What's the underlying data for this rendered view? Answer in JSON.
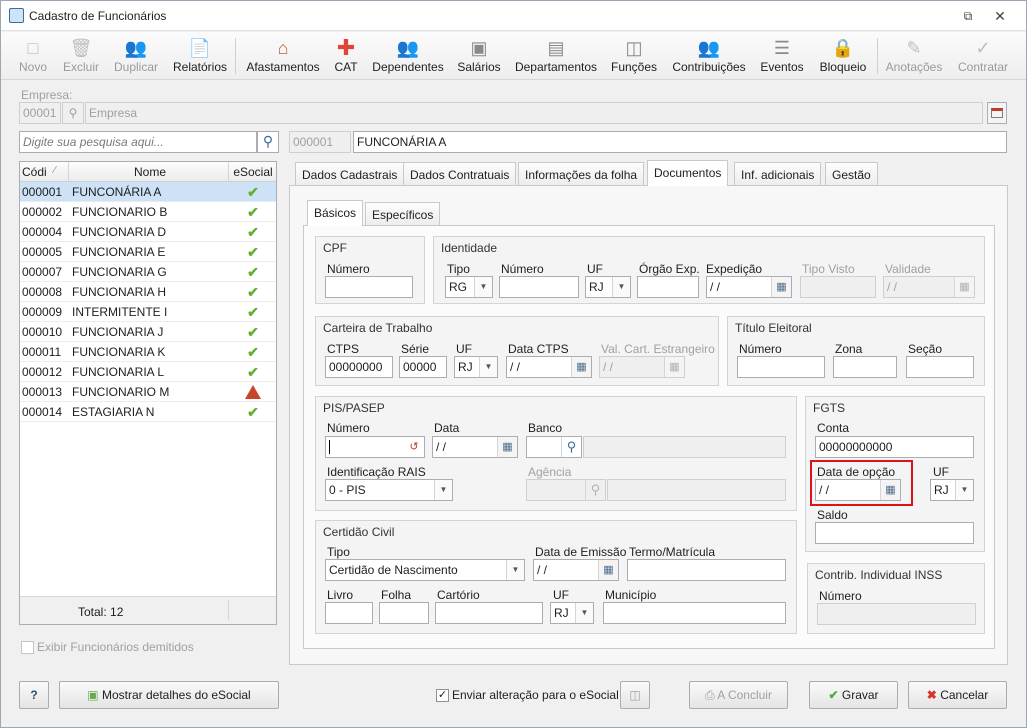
{
  "window": {
    "title": "Cadastro de Funcionários"
  },
  "toolbar": {
    "items": [
      {
        "label": "Novo",
        "icon": "new-doc-icon",
        "enabled": false
      },
      {
        "label": "Excluir",
        "icon": "trash-icon",
        "enabled": false
      },
      {
        "label": "Duplicar",
        "icon": "duplicate-users-icon",
        "enabled": false
      },
      {
        "label": "Relatórios",
        "icon": "report-icon",
        "enabled": true
      },
      {
        "label": "Afastamentos",
        "icon": "house-arrow-icon",
        "enabled": true
      },
      {
        "label": "CAT",
        "icon": "red-cross-icon",
        "enabled": true
      },
      {
        "label": "Dependentes",
        "icon": "people-icon",
        "enabled": true
      },
      {
        "label": "Salários",
        "icon": "money-icon",
        "enabled": true
      },
      {
        "label": "Departamentos",
        "icon": "desk-icon",
        "enabled": true
      },
      {
        "label": "Funções",
        "icon": "badge-icon",
        "enabled": true
      },
      {
        "label": "Contribuições",
        "icon": "contrib-people-icon",
        "enabled": true
      },
      {
        "label": "Eventos",
        "icon": "list-icon",
        "enabled": true
      },
      {
        "label": "Bloqueio",
        "icon": "lock-icon",
        "enabled": true
      },
      {
        "label": "Anotações",
        "icon": "notes-icon",
        "enabled": false
      },
      {
        "label": "Contratar",
        "icon": "hire-icon",
        "enabled": false
      }
    ]
  },
  "empresa": {
    "label": "Empresa:",
    "code": "00001",
    "name": "Empresa"
  },
  "search": {
    "placeholder": "Digite sua pesquisa aqui..."
  },
  "employee": {
    "code": "000001",
    "name": "FUNCONÁRIA A"
  },
  "grid": {
    "columns": [
      "Códi",
      "Nome",
      "eSocial"
    ],
    "rows": [
      {
        "code": "000001",
        "name": "FUNCONÁRIA A",
        "status": "ok"
      },
      {
        "code": "000002",
        "name": "FUNCIONARIO B",
        "status": "ok"
      },
      {
        "code": "000004",
        "name": "FUNCIONARIA D",
        "status": "ok"
      },
      {
        "code": "000005",
        "name": "FUNCIONARIA E",
        "status": "ok"
      },
      {
        "code": "000007",
        "name": "FUNCIONARIA G",
        "status": "ok"
      },
      {
        "code": "000008",
        "name": "FUNCIONARIA H",
        "status": "ok"
      },
      {
        "code": "000009",
        "name": "INTERMITENTE I",
        "status": "ok"
      },
      {
        "code": "000010",
        "name": "FUNCIONARIA J",
        "status": "ok"
      },
      {
        "code": "000011",
        "name": "FUNCIONARIA K",
        "status": "ok"
      },
      {
        "code": "000012",
        "name": "FUNCIONARIA L",
        "status": "ok"
      },
      {
        "code": "000013",
        "name": "FUNCIONARIO M",
        "status": "warning"
      },
      {
        "code": "000014",
        "name": "ESTAGIARIA N",
        "status": "ok"
      }
    ],
    "total": "Total: 12"
  },
  "show_dismissed": "Exibir Funcionários demitidos",
  "tabs": [
    "Dados Cadastrais",
    "Dados Contratuais",
    "Informações da folha",
    "Documentos",
    "Inf. adicionais",
    "Gestão"
  ],
  "subtabs": [
    "Básicos",
    "Específicos"
  ],
  "cpf": {
    "title": "CPF",
    "numero_label": "Número"
  },
  "identidade": {
    "title": "Identidade",
    "tipo_label": "Tipo",
    "tipo": "RG",
    "numero_label": "Número",
    "uf_label": "UF",
    "uf": "RJ",
    "orgao_label": "Órgão Exp.",
    "expedicao_label": "Expedição",
    "expedicao": " / /",
    "tipo_visto_label": "Tipo Visto",
    "validade_label": "Validade",
    "validade": " / /"
  },
  "ctps": {
    "title": "Carteira de Trabalho",
    "ctps_label": "CTPS",
    "ctps": "00000000",
    "serie_label": "Série",
    "serie": "00000",
    "uf_label": "UF",
    "uf": "RJ",
    "data_label": "Data CTPS",
    "data": " / /",
    "val_label": "Val. Cart. Estrangeiro",
    "val": " / /"
  },
  "titulo": {
    "title": "Título Eleitoral",
    "numero_label": "Número",
    "zona_label": "Zona",
    "secao_label": "Seção"
  },
  "pis": {
    "title": "PIS/PASEP",
    "numero_label": "Número",
    "data_label": "Data",
    "data": " / /",
    "banco_label": "Banco",
    "rais_label": "Identificação RAIS",
    "rais": "0 - PIS",
    "agencia_label": "Agência"
  },
  "fgts": {
    "title": "FGTS",
    "conta_label": "Conta",
    "conta": "00000000000",
    "opcao_label": "Data de opção",
    "opcao": " / /",
    "uf_label": "UF",
    "uf": "RJ",
    "saldo_label": "Saldo"
  },
  "certidao": {
    "title": "Certidão Civil",
    "tipo_label": "Tipo",
    "tipo": "Certidão de Nascimento",
    "emissao_label": "Data de Emissão",
    "emissao": " / /",
    "termo_label": "Termo/Matrícula",
    "livro_label": "Livro",
    "folha_label": "Folha",
    "cartorio_label": "Cartório",
    "uf_label": "UF",
    "uf": "RJ",
    "municipio_label": "Município"
  },
  "inss": {
    "title": "Contrib. Individual INSS",
    "numero_label": "Número"
  },
  "footer": {
    "help": "?",
    "esocial_details": "Mostrar detalhes do eSocial",
    "send_change": "Enviar alteração para o eSocial",
    "concluir": "A Concluir",
    "gravar": "Gravar",
    "cancelar": "Cancelar"
  },
  "colors": {
    "highlight": "#d9141b",
    "selected_row": "#cde2f6"
  }
}
